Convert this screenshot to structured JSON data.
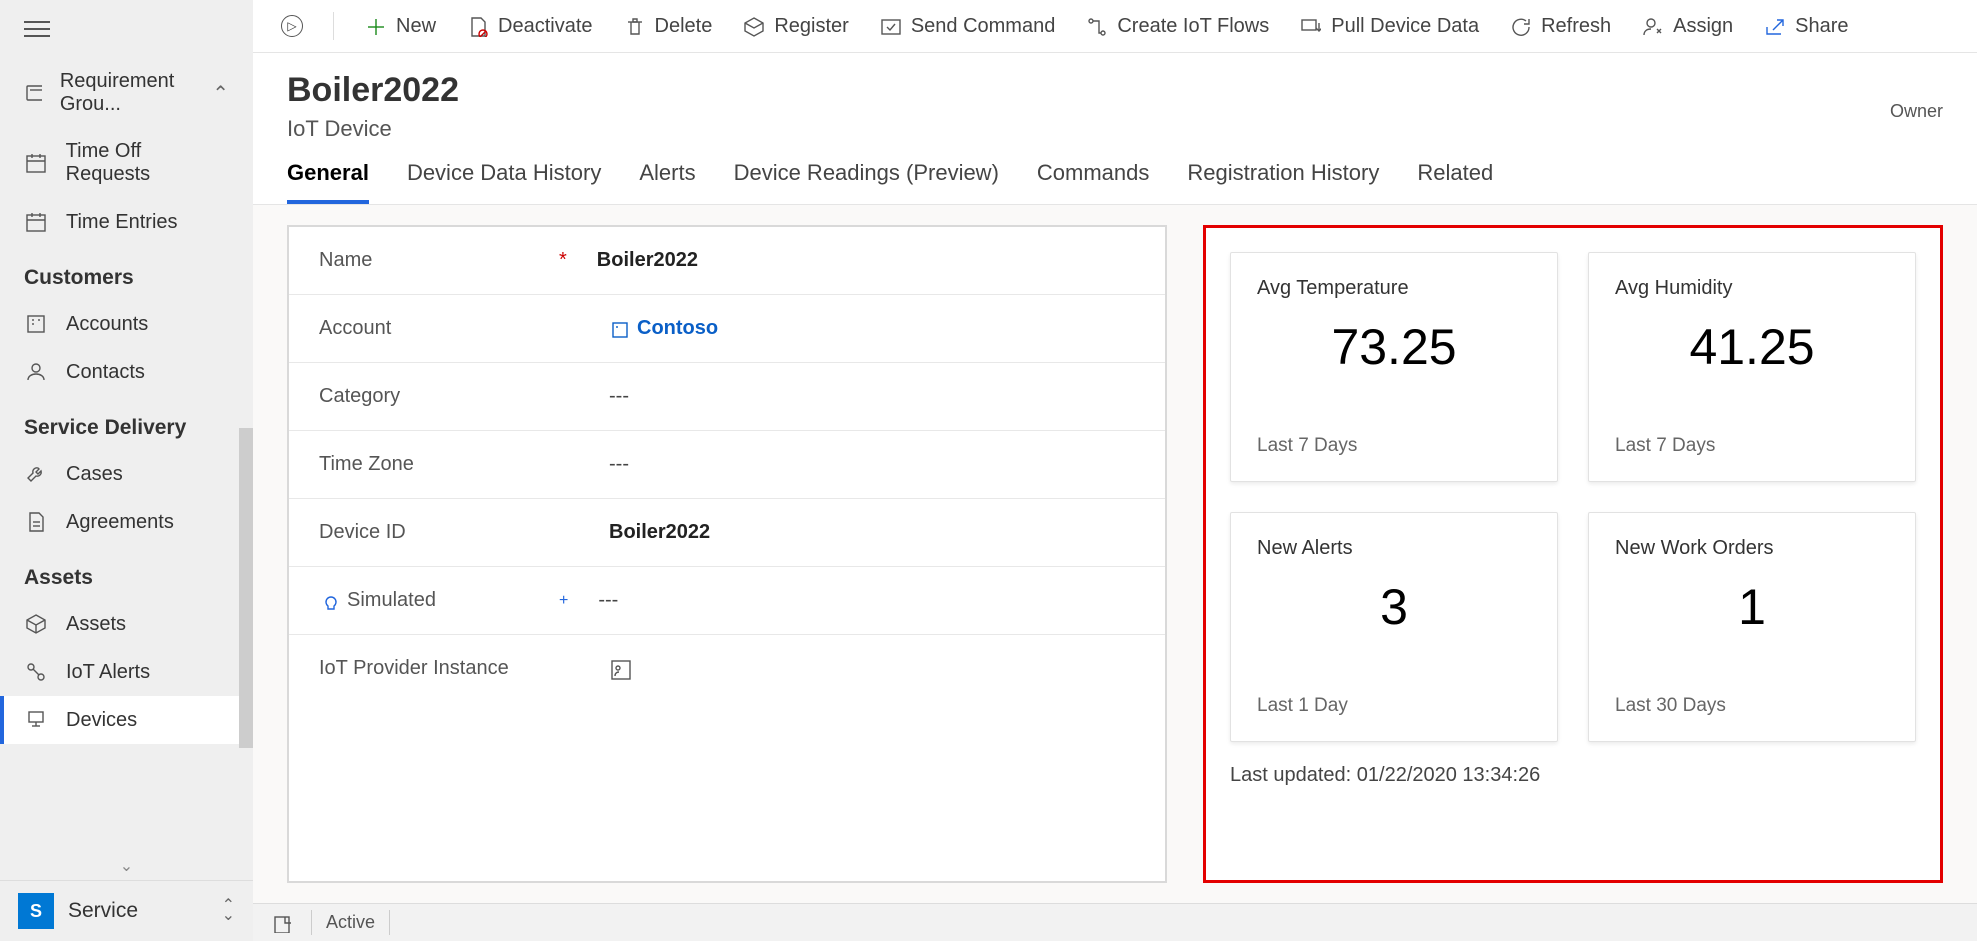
{
  "sidebar": {
    "top_items": [
      {
        "label": "Requirement Grou..."
      },
      {
        "label": "Time Off Requests"
      },
      {
        "label": "Time Entries"
      }
    ],
    "sections": [
      {
        "title": "Customers",
        "items": [
          {
            "label": "Accounts"
          },
          {
            "label": "Contacts"
          }
        ]
      },
      {
        "title": "Service Delivery",
        "items": [
          {
            "label": "Cases"
          },
          {
            "label": "Agreements"
          }
        ]
      },
      {
        "title": "Assets",
        "items": [
          {
            "label": "Assets"
          },
          {
            "label": "IoT Alerts"
          },
          {
            "label": "Devices"
          }
        ]
      }
    ],
    "app_tile": "S",
    "app_name": "Service"
  },
  "commands": {
    "new": "New",
    "deactivate": "Deactivate",
    "delete": "Delete",
    "register": "Register",
    "send_command": "Send Command",
    "create_flows": "Create IoT Flows",
    "pull_data": "Pull Device Data",
    "refresh": "Refresh",
    "assign": "Assign",
    "share": "Share"
  },
  "header": {
    "title": "Boiler2022",
    "subtitle": "IoT Device",
    "owner_label": "Owner"
  },
  "tabs": [
    {
      "label": "General",
      "active": true
    },
    {
      "label": "Device Data History"
    },
    {
      "label": "Alerts"
    },
    {
      "label": "Device Readings (Preview)"
    },
    {
      "label": "Commands"
    },
    {
      "label": "Registration History"
    },
    {
      "label": "Related"
    }
  ],
  "fields": {
    "name": {
      "label": "Name",
      "value": "Boiler2022"
    },
    "account": {
      "label": "Account",
      "value": "Contoso"
    },
    "category": {
      "label": "Category",
      "value": "---"
    },
    "timezone": {
      "label": "Time Zone",
      "value": "---"
    },
    "device_id": {
      "label": "Device ID",
      "value": "Boiler2022"
    },
    "simulated": {
      "label": "Simulated",
      "value": "---"
    },
    "provider": {
      "label": "IoT Provider Instance",
      "value": ""
    }
  },
  "summary": {
    "cards": [
      {
        "title": "Avg Temperature",
        "value": "73.25",
        "sub": "Last 7 Days"
      },
      {
        "title": "Avg Humidity",
        "value": "41.25",
        "sub": "Last 7 Days"
      },
      {
        "title": "New Alerts",
        "value": "3",
        "sub": "Last 1 Day"
      },
      {
        "title": "New Work Orders",
        "value": "1",
        "sub": "Last 30 Days"
      }
    ],
    "last_updated": "Last updated: 01/22/2020 13:34:26"
  },
  "status": {
    "text": "Active"
  }
}
